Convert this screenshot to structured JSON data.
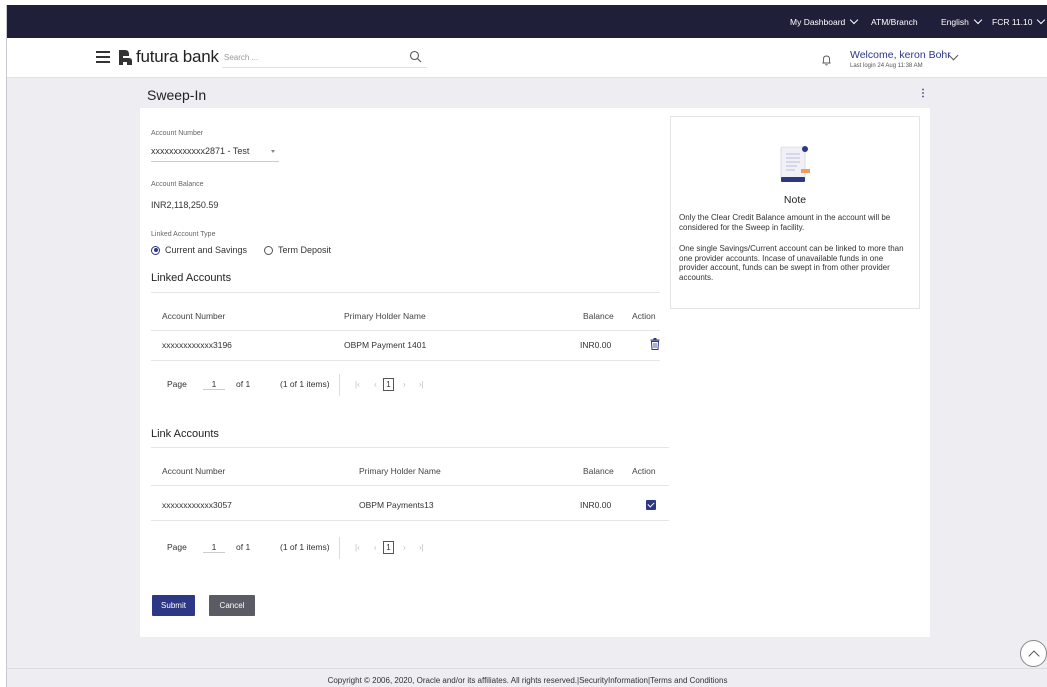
{
  "topbar": {
    "my_dashboard": "My Dashboard",
    "atm_branch": "ATM/Branch",
    "language": "English",
    "version": "FCR 11.10"
  },
  "header": {
    "brand": "futura bank",
    "search_placeholder": "Search ...",
    "welcome": "Welcome, keron Bohr",
    "last_login": "Last login 24 Aug 11:38 AM"
  },
  "page": {
    "title": "Sweep-In"
  },
  "form": {
    "account_number_label": "Account Number",
    "account_number_value": "xxxxxxxxxxxx2871 - Test",
    "account_balance_label": "Account Balance",
    "account_balance_value": "INR2,118,250.59",
    "linked_type_label": "Linked Account Type",
    "linked_type_options": [
      "Current and Savings",
      "Term Deposit"
    ],
    "linked_type_selected": "Current and Savings"
  },
  "linked_accounts": {
    "title": "Linked Accounts",
    "columns": [
      "Account Number",
      "Primary Holder Name",
      "Balance",
      "Action"
    ],
    "rows": [
      {
        "account": "xxxxxxxxxxxx3196",
        "holder": "OBPM Payment 1401",
        "balance": "INR0.00",
        "action": "delete-icon"
      }
    ],
    "pager": {
      "page_label": "Page",
      "page": "1",
      "of": "of 1",
      "items": "(1 of 1 items)",
      "current": "1"
    }
  },
  "link_accounts": {
    "title": "Link Accounts",
    "columns": [
      "Account Number",
      "Primary Holder Name",
      "Balance",
      "Action"
    ],
    "rows": [
      {
        "account": "xxxxxxxxxxxx3057",
        "holder": "OBPM Payments13",
        "balance": "INR0.00",
        "action": "checkbox-checked"
      }
    ],
    "pager": {
      "page_label": "Page",
      "page": "1",
      "of": "of 1",
      "items": "(1 of 1 items)",
      "current": "1"
    }
  },
  "buttons": {
    "submit": "Submit",
    "cancel": "Cancel"
  },
  "note": {
    "title": "Note",
    "p1": "Only the Clear Credit Balance amount in the account will be considered for the Sweep in facility.",
    "p2": "One single Savings/Current account can be linked to more than one provider accounts. Incase of unavailable funds in one provider account, funds can be swept in from other provider accounts."
  },
  "footer": {
    "text": "Copyright © 2006, 2020, Oracle and/or its affiliates. All rights reserved.|SecurityInformation|Terms and Conditions"
  },
  "colors": {
    "topbar": "#1f1f3a",
    "accent": "#2c3785",
    "background": "#ededf2",
    "cancel_button": "#5b5b66"
  }
}
